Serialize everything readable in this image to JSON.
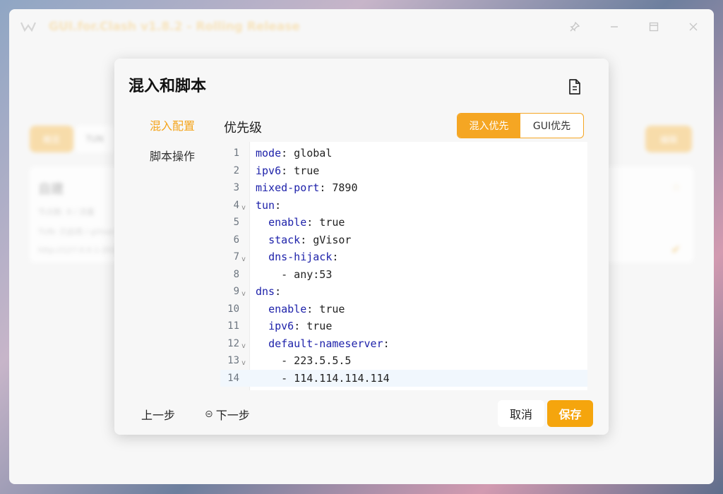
{
  "window": {
    "title": "GUI.for.Clash v1.8.2 - Rolling Release",
    "controls": [
      "pin-icon",
      "minimize-icon",
      "maximize-icon",
      "close-icon"
    ]
  },
  "background": {
    "tab_active": "概览",
    "tab": "TUN",
    "action": "编辑",
    "card_title": "自建",
    "card_lines": [
      "节点数: 8 / 流量",
      "TUN: 已启用 / gVisor",
      "http://127.0.0.1:20112"
    ]
  },
  "modal": {
    "title": "混入和脚本",
    "nav": [
      {
        "label": "混入配置",
        "active": true
      },
      {
        "label": "脚本操作",
        "active": false
      }
    ],
    "section_label": "优先级",
    "priority_options": [
      {
        "label": "混入优先",
        "active": true
      },
      {
        "label": "GUI优先",
        "active": false
      }
    ],
    "editor": {
      "highlighted_line": 14,
      "lines": [
        {
          "n": "1",
          "fold": false,
          "key": "mode",
          "rest": ": global",
          "indent": ""
        },
        {
          "n": "2",
          "fold": false,
          "key": "ipv6",
          "rest": ": true",
          "indent": ""
        },
        {
          "n": "3",
          "fold": false,
          "key": "mixed-port",
          "rest": ": 7890",
          "indent": ""
        },
        {
          "n": "4",
          "fold": true,
          "key": "tun",
          "rest": ":",
          "indent": ""
        },
        {
          "n": "5",
          "fold": false,
          "key": "enable",
          "rest": ": true",
          "indent": "  "
        },
        {
          "n": "6",
          "fold": false,
          "key": "stack",
          "rest": ": gVisor",
          "indent": "  "
        },
        {
          "n": "7",
          "fold": true,
          "key": "dns-hijack",
          "rest": ":",
          "indent": "  "
        },
        {
          "n": "8",
          "fold": false,
          "key": "",
          "rest": "- any:53",
          "indent": "    "
        },
        {
          "n": "9",
          "fold": true,
          "key": "dns",
          "rest": ":",
          "indent": ""
        },
        {
          "n": "10",
          "fold": false,
          "key": "enable",
          "rest": ": true",
          "indent": "  "
        },
        {
          "n": "11",
          "fold": false,
          "key": "ipv6",
          "rest": ": true",
          "indent": "  "
        },
        {
          "n": "12",
          "fold": true,
          "key": "default-nameserver",
          "rest": ":",
          "indent": "  "
        },
        {
          "n": "13",
          "fold": true,
          "key": "",
          "rest": "- 223.5.5.5",
          "indent": "    "
        },
        {
          "n": "14",
          "fold": false,
          "key": "",
          "rest": "- 114.114.114.114",
          "indent": "    "
        }
      ]
    },
    "prev_label": "上一步",
    "next_label": "下一步",
    "cancel_label": "取消",
    "save_label": "保存"
  },
  "colors": {
    "accent": "#f5a623",
    "key": "#1e22aa"
  }
}
